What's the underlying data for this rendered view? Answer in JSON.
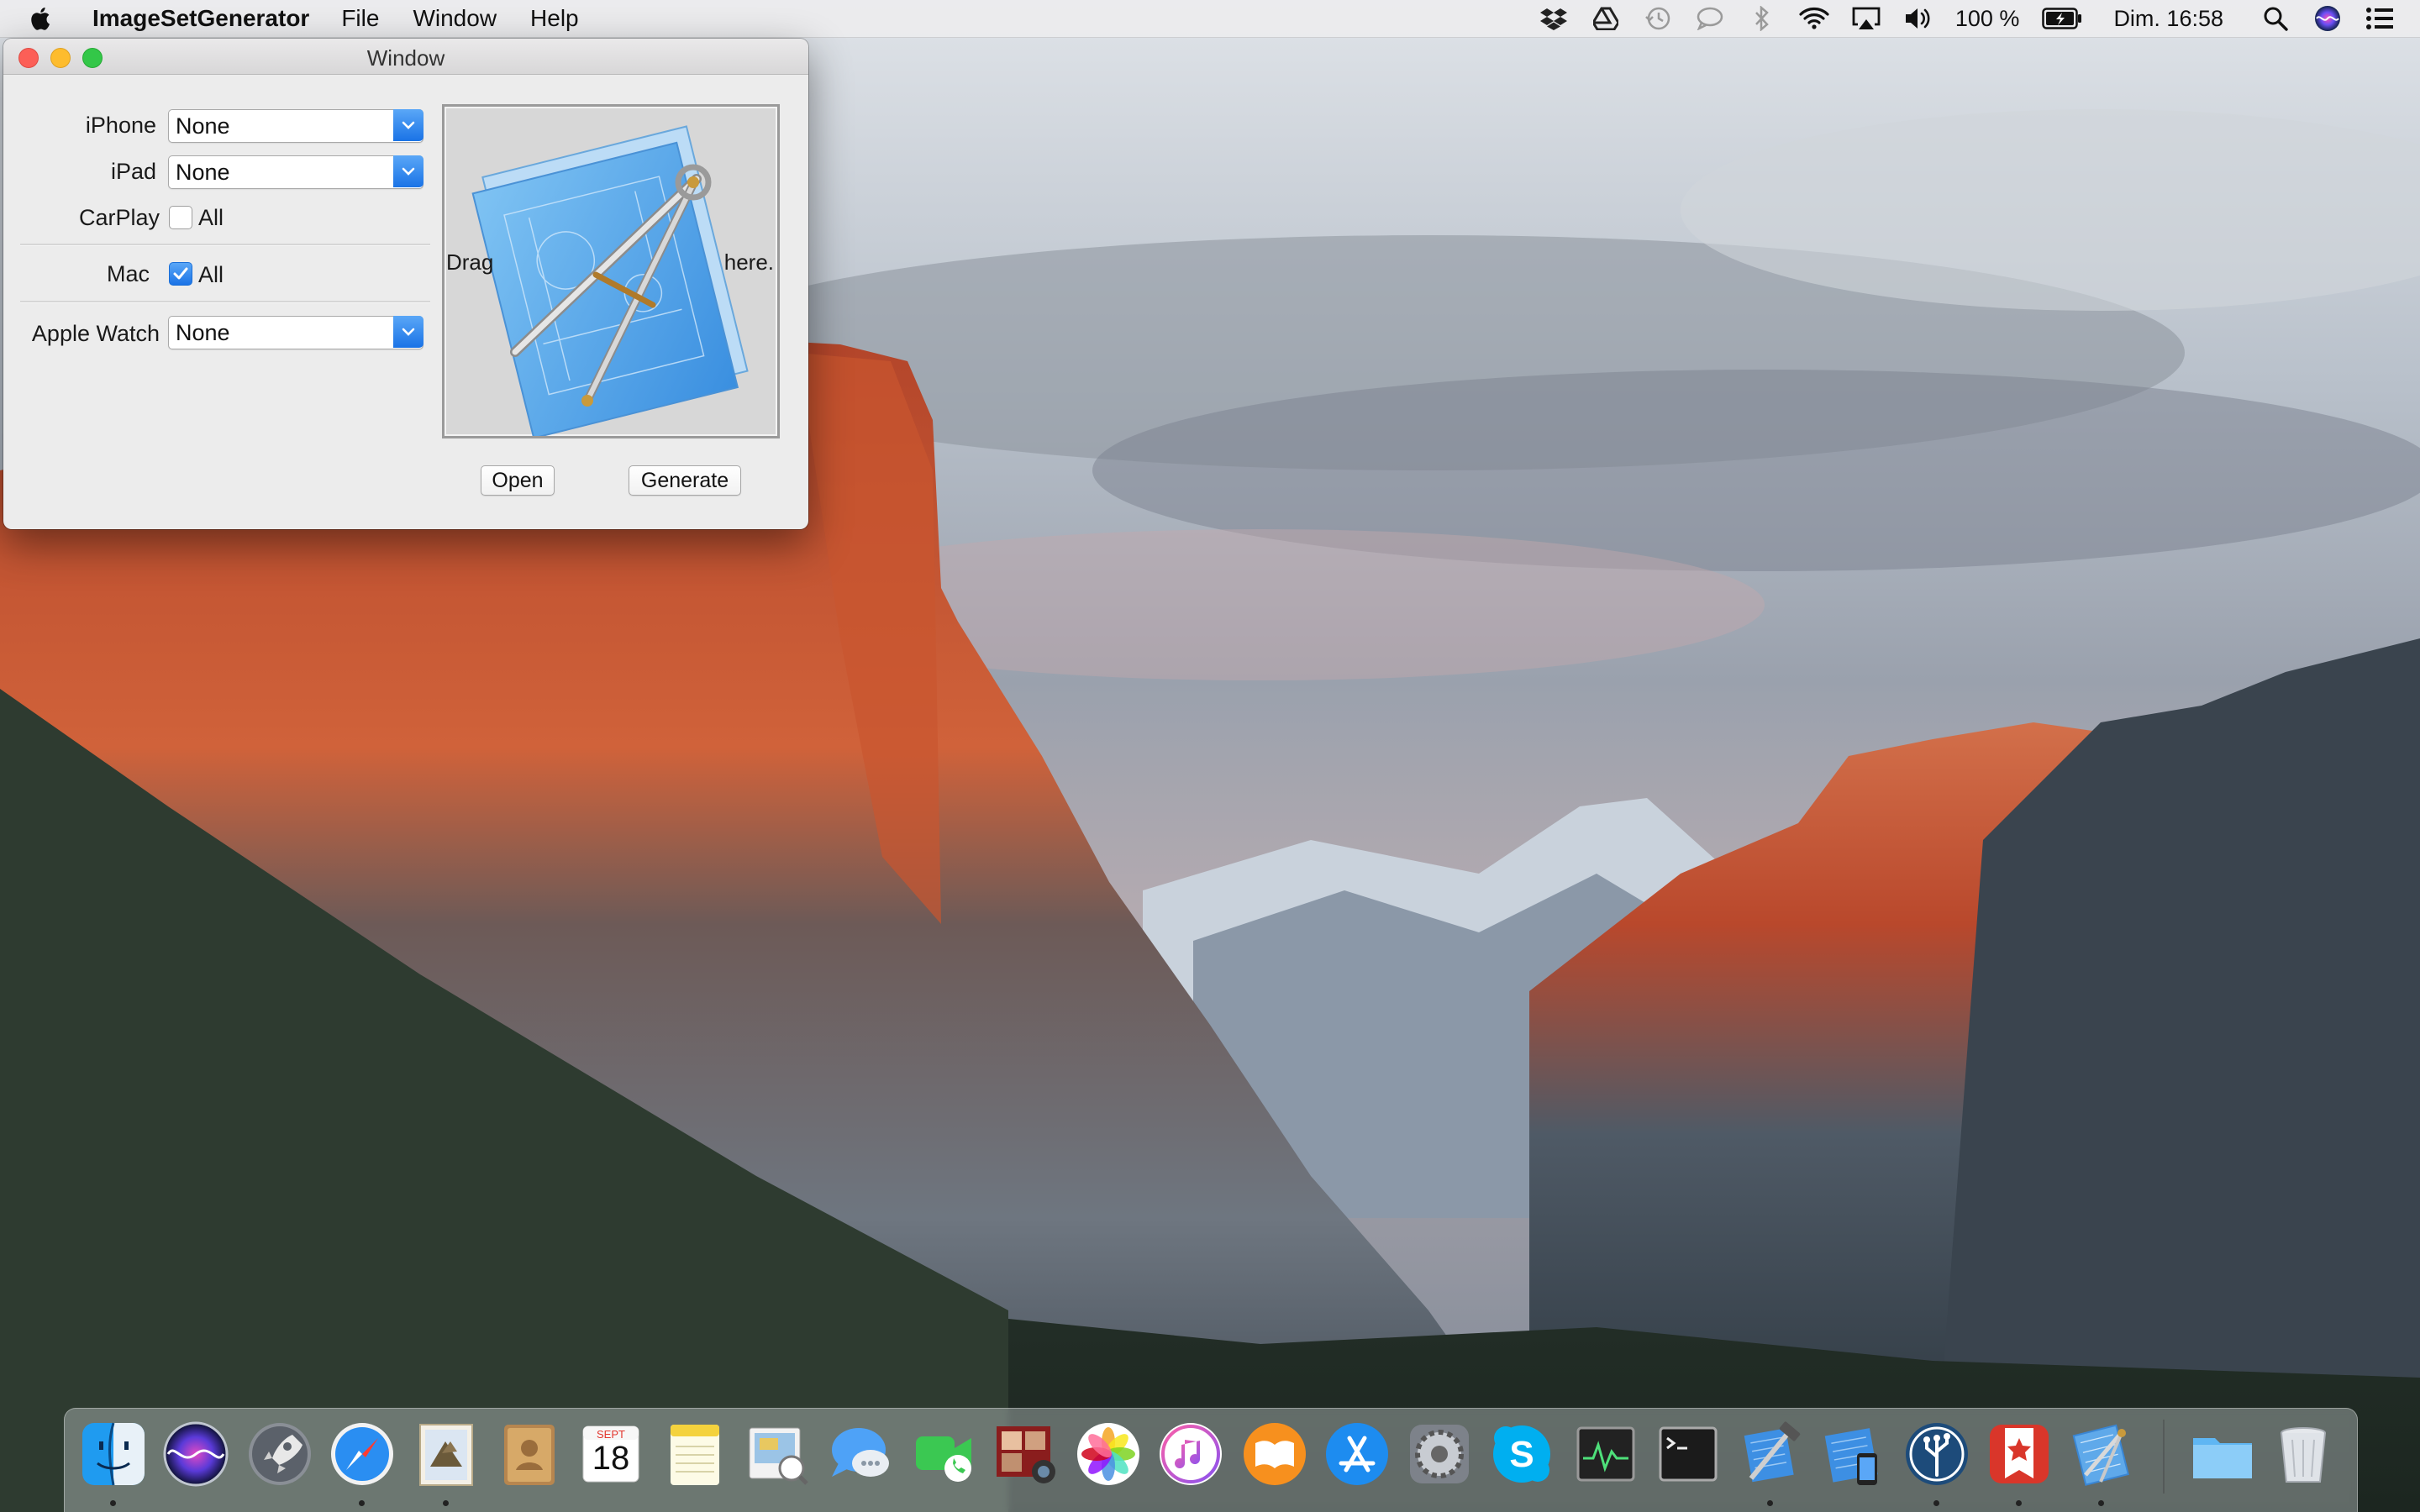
{
  "menubar": {
    "app_name": "ImageSetGenerator",
    "menus": [
      "File",
      "Window",
      "Help"
    ],
    "battery": "100 %",
    "clock": "Dim. 16:58",
    "status_icons": [
      "dropbox-icon",
      "google-drive-icon",
      "time-machine-icon",
      "messages-status-icon",
      "bluetooth-icon",
      "wifi-icon",
      "airplay-icon",
      "volume-icon",
      "battery-icon",
      "spotlight-icon",
      "siri-icon",
      "notification-center-icon"
    ]
  },
  "window": {
    "title": "Window",
    "iphone": {
      "label": "iPhone",
      "value": "None"
    },
    "ipad": {
      "label": "iPad",
      "value": "None"
    },
    "carplay": {
      "label": "CarPlay",
      "checkbox_label": "All",
      "checked": false
    },
    "mac": {
      "label": "Mac",
      "checkbox_label": "All",
      "checked": true
    },
    "apple_watch": {
      "label": "Apple Watch",
      "value": "None"
    },
    "drop_left": "Drag",
    "drop_right": "here.",
    "open_button": "Open",
    "generate_button": "Generate"
  },
  "dock": {
    "calendar_month": "SEPT",
    "calendar_day": "18",
    "apps": [
      "Finder",
      "Siri",
      "Launchpad",
      "Safari",
      "Mail",
      "Contacts",
      "Calendar",
      "Notes",
      "Preview",
      "Messages",
      "FaceTime",
      "Photo Booth",
      "Photos",
      "iTunes",
      "iBooks",
      "App Store",
      "System Preferences",
      "Skype",
      "Activity Monitor",
      "Terminal",
      "Xcode",
      "Simulator",
      "SourceTree",
      "Wunderlist",
      "Sketch Tool",
      "Downloads",
      "Trash"
    ]
  },
  "colors": {
    "accent": "#1a73e6",
    "close": "#fc5f57",
    "minimize": "#fdbc2e",
    "zoom": "#33c748"
  }
}
